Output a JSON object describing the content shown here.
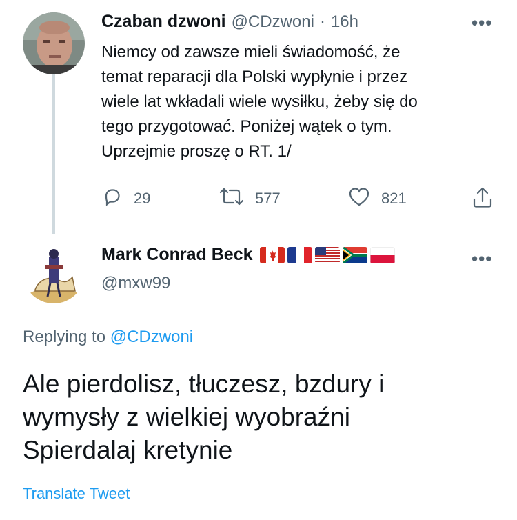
{
  "tweet1": {
    "author_name": "Czaban dzwoni",
    "handle": "@CDzwoni",
    "separator": "·",
    "time": "16h",
    "more": "•••",
    "text": "Niemcy od zawsze mieli świadomość, że\ntemat reparacji dla Polski wypłynie i przez\nwiele lat wkładali wiele wysiłku, żeby się do\ntego przygotować. Poniżej wątek o tym.\nUprzejmie proszę o RT. 1/",
    "replies": "29",
    "retweets": "577",
    "likes": "821"
  },
  "tweet2": {
    "author_name": "Mark Conrad Beck",
    "handle": "@mxw99",
    "more": "•••",
    "flags": [
      "canada-flag",
      "france-flag",
      "usa-flag",
      "south-africa-flag",
      "poland-flag"
    ],
    "replying_prefix": "Replying to",
    "replying_handle": "@CDzwoni",
    "text": "Ale pierdolisz, tłuczesz, bzdury i\nwymysły z wielkiej wyobraźni\nSpierdalaj kretynie",
    "translate": "Translate Tweet"
  },
  "colors": {
    "text": "#0f1419",
    "muted": "#536471",
    "link": "#1d9bf0",
    "thread": "#cfd9de"
  }
}
